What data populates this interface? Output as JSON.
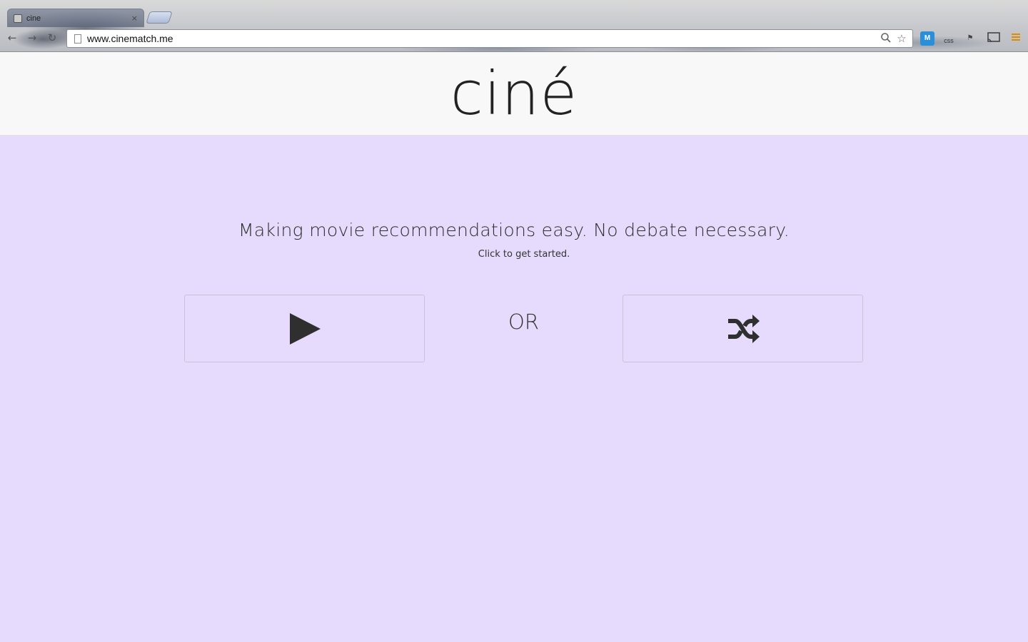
{
  "browser": {
    "tab_title": "cine",
    "tab_close": "×",
    "url": "www.cinematch.me",
    "extensions": {
      "m_label": "M",
      "css_label": "css"
    }
  },
  "page": {
    "logo": "ciné",
    "tagline": "Making movie recommendations easy. No debate necessary.",
    "subtext": "Click to get started.",
    "or_text": "OR"
  },
  "colors": {
    "background": "#e6dbfc",
    "header_bg": "#f8f8f8",
    "icon": "#2f2f2f"
  }
}
